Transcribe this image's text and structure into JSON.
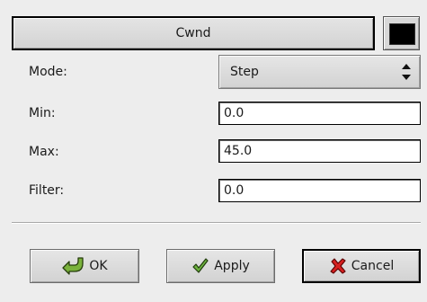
{
  "header": {
    "title_label": "Cwnd",
    "color_value": "#000000"
  },
  "form": {
    "mode_label": "Mode:",
    "mode_value": "Step",
    "min_label": "Min:",
    "min_value": "0.0",
    "max_label": "Max:",
    "max_value": "45.0",
    "filter_label": "Filter:",
    "filter_value": "0.0"
  },
  "buttons": {
    "ok_label": "OK",
    "ok_icon": "ok-icon",
    "apply_label": "Apply",
    "apply_icon": "check-icon",
    "cancel_label": "Cancel",
    "cancel_icon": "x-icon"
  }
}
